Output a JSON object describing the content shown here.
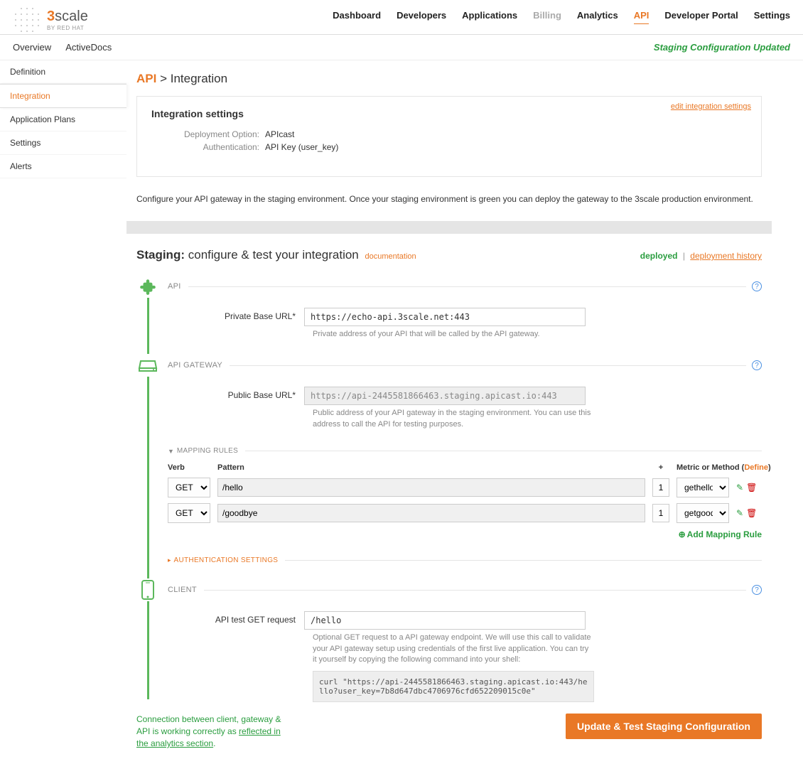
{
  "brand": {
    "name_html": "3scale",
    "byline": "BY RED HAT"
  },
  "topnav": [
    "Dashboard",
    "Developers",
    "Applications",
    "Billing",
    "Analytics",
    "API",
    "Developer Portal",
    "Settings"
  ],
  "subnav": [
    "Overview",
    "ActiveDocs"
  ],
  "status_message": "Staging Configuration Updated",
  "sidebar": [
    "Definition",
    "Integration",
    "Application Plans",
    "Settings",
    "Alerts"
  ],
  "breadcrumb": {
    "root": "API",
    "sep": ">",
    "page": "Integration"
  },
  "panel": {
    "edit_link": "edit integration settings",
    "title": "Integration settings",
    "deployment_option_label": "Deployment Option:",
    "deployment_option_value": "APIcast",
    "authentication_label": "Authentication:",
    "authentication_value": "API Key (user_key)"
  },
  "blurb": "Configure your API gateway in the staging environment. Once your staging environment is green you can deploy the gateway to the 3scale production environment.",
  "staging": {
    "title_bold": "Staging:",
    "title_rest": "configure & test your integration",
    "doc_link": "documentation",
    "deployed": "deployed",
    "sep": "|",
    "history": "deployment history"
  },
  "api_section": {
    "label": "API",
    "private_base_url_label": "Private Base URL*",
    "private_base_url_value": "https://echo-api.3scale.net:443",
    "private_base_url_hint": "Private address of your API that will be called by the API gateway."
  },
  "gateway_section": {
    "label": "API GATEWAY",
    "public_base_url_label": "Public Base URL*",
    "public_base_url_value": "https://api-2445581866463.staging.apicast.io:443",
    "public_base_url_hint": "Public address of your API gateway in the staging environment. You can use this address to call the API for testing purposes."
  },
  "mapping": {
    "section_label": "MAPPING RULES",
    "headers": {
      "verb": "Verb",
      "pattern": "Pattern",
      "plus": "+",
      "metric": "Metric or Method",
      "define": "Define"
    },
    "rows": [
      {
        "verb": "GET",
        "pattern": "/hello",
        "plus": "1",
        "metric": "gethello"
      },
      {
        "verb": "GET",
        "pattern": "/goodbye",
        "plus": "1",
        "metric": "getgoodby"
      }
    ],
    "add_label": "Add Mapping Rule"
  },
  "auth_section": {
    "label": "AUTHENTICATION SETTINGS"
  },
  "client_section": {
    "label": "CLIENT",
    "test_label": "API test GET request",
    "test_value": "/hello",
    "test_hint": "Optional GET request to a API gateway endpoint. We will use this call to validate your API gateway setup using credentials of the first live application. You can try it yourself by copying the following command into your shell:",
    "curl": "curl \"https://api-2445581866463.staging.apicast.io:443/hello?user_key=7b8d647dbc4706976cfd652209015c0e\""
  },
  "connection_status": {
    "pre": "Connection between client, gateway & API is working correctly as ",
    "link": "reflected in the analytics section",
    "post": "."
  },
  "button": "Update & Test Staging Configuration"
}
